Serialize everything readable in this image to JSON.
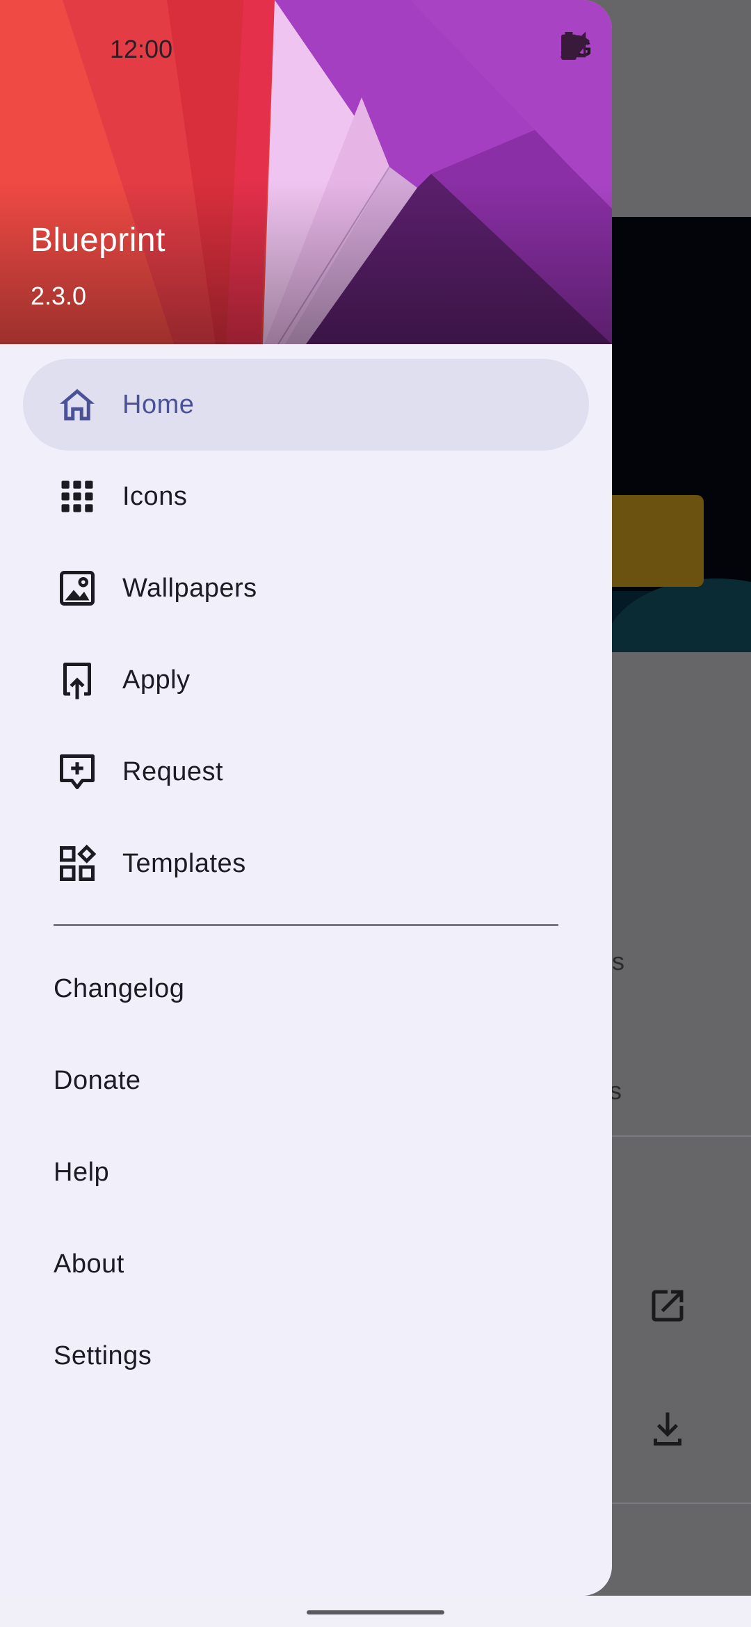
{
  "status_bar": {
    "time": "12:00",
    "network": "3G"
  },
  "drawer": {
    "header": {
      "app_name": "Blueprint",
      "version": "2.3.0"
    },
    "primary_items": [
      {
        "label": "Home",
        "icon": "home-icon",
        "active": true
      },
      {
        "label": "Icons",
        "icon": "grid-icon",
        "active": false
      },
      {
        "label": "Wallpapers",
        "icon": "image-icon",
        "active": false
      },
      {
        "label": "Apply",
        "icon": "apply-icon",
        "active": false
      },
      {
        "label": "Request",
        "icon": "request-icon",
        "active": false
      },
      {
        "label": "Templates",
        "icon": "templates-icon",
        "active": false
      }
    ],
    "secondary_items": [
      {
        "label": "Changelog"
      },
      {
        "label": "Donate"
      },
      {
        "label": "Help"
      },
      {
        "label": "About"
      },
      {
        "label": "Settings"
      }
    ]
  },
  "background": {
    "partial_text_1": "rs",
    "partial_text_2": "s"
  },
  "colors": {
    "drawer_bg": "#f1effa",
    "active_pill": "#dfdff0",
    "active_text": "#4a5196",
    "scrim": "#676569"
  }
}
